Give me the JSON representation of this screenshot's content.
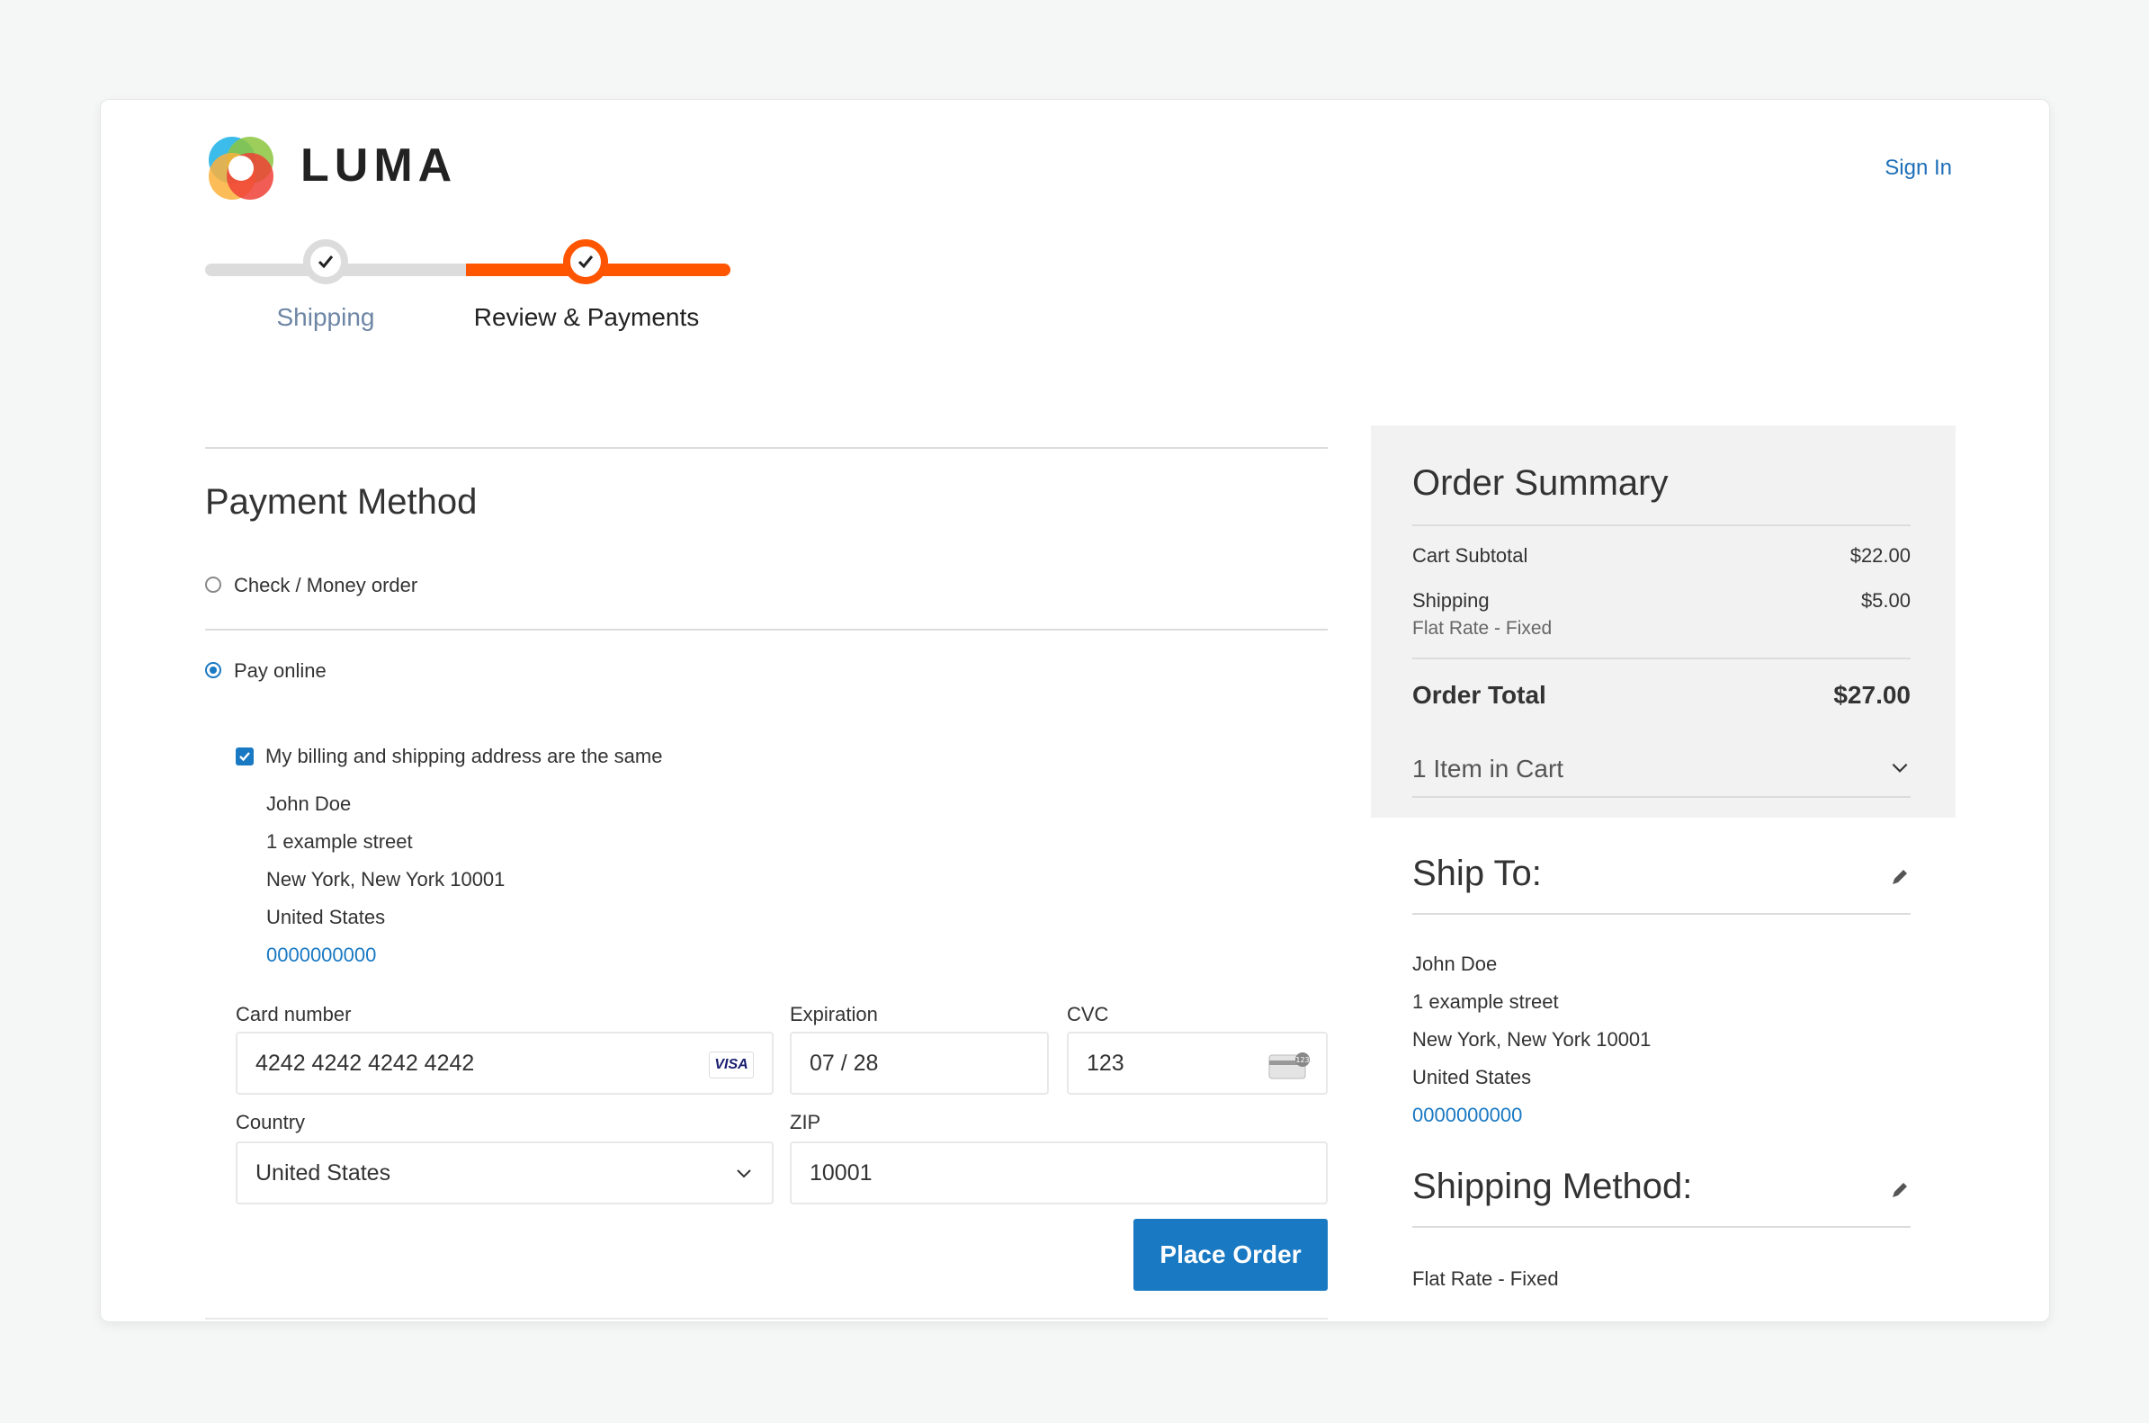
{
  "header": {
    "logo_text": "LUMA",
    "sign_in": "Sign In",
    "brand_colors": {
      "orange": "#ff5501",
      "blue": "#1979c3"
    }
  },
  "progress": {
    "steps": [
      {
        "label": "Shipping",
        "state": "complete"
      },
      {
        "label": "Review & Payments",
        "state": "active"
      }
    ]
  },
  "payment": {
    "title": "Payment Method",
    "options": [
      {
        "label": "Check / Money order",
        "selected": false
      },
      {
        "label": "Pay online",
        "selected": true
      }
    ],
    "same_address_label": "My billing and shipping address are the same",
    "same_address_checked": true,
    "billing_address": {
      "name": "John Doe",
      "street": "1 example street",
      "city_line": "New York, New York 10001",
      "country": "United States",
      "phone": "0000000000"
    },
    "card": {
      "number_label": "Card number",
      "number_value": "4242 4242 4242 4242",
      "brand": "VISA",
      "expiration_label": "Expiration",
      "expiration_value": "07 / 28",
      "cvc_label": "CVC",
      "cvc_value": "123",
      "country_label": "Country",
      "country_value": "United States",
      "zip_label": "ZIP",
      "zip_value": "10001"
    },
    "place_order": "Place Order"
  },
  "summary": {
    "title": "Order Summary",
    "rows": [
      {
        "label": "Cart Subtotal",
        "value": "$22.00"
      },
      {
        "label": "Shipping",
        "sublabel": "Flat Rate - Fixed",
        "value": "$5.00"
      }
    ],
    "total_label": "Order Total",
    "total_value": "$27.00",
    "items_in_cart": "1 Item in Cart"
  },
  "ship_to": {
    "title": "Ship To:",
    "name": "John Doe",
    "street": "1 example street",
    "city_line": "New York, New York 10001",
    "country": "United States",
    "phone": "0000000000"
  },
  "shipping_method": {
    "title": "Shipping Method:",
    "value": "Flat Rate - Fixed"
  }
}
